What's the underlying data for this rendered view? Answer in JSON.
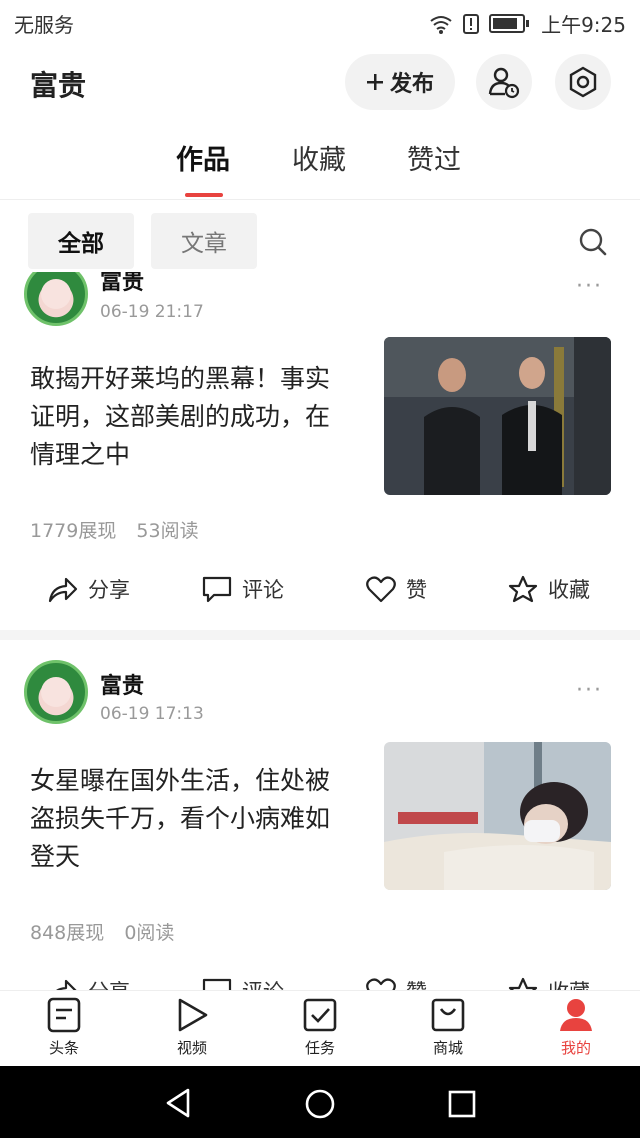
{
  "status_bar": {
    "carrier": "无服务",
    "time": "上午9:25"
  },
  "header": {
    "username": "富贵",
    "publish_label": "发布"
  },
  "tabs": [
    "作品",
    "收藏",
    "赞过"
  ],
  "filters": [
    "全部",
    "文章"
  ],
  "posts": [
    {
      "author": "富贵",
      "time": "06-19 21:17",
      "title": "敢揭开好莱坞的黑幕！事实证明，这部美剧的成功，在情理之中",
      "impressions": "1779展现",
      "reads": "53阅读"
    },
    {
      "author": "富贵",
      "time": "06-19 17:13",
      "title": "女星曝在国外生活，住处被盗损失千万，看个小病难如登天",
      "impressions": "848展现",
      "reads": "0阅读"
    }
  ],
  "actions": {
    "share": "分享",
    "comment": "评论",
    "like": "赞",
    "favorite": "收藏"
  },
  "bottom_nav": [
    "头条",
    "视频",
    "任务",
    "商城",
    "我的"
  ],
  "colors": {
    "accent": "#e8433f",
    "chip_bg": "#f2f2f2",
    "muted": "#999999"
  }
}
